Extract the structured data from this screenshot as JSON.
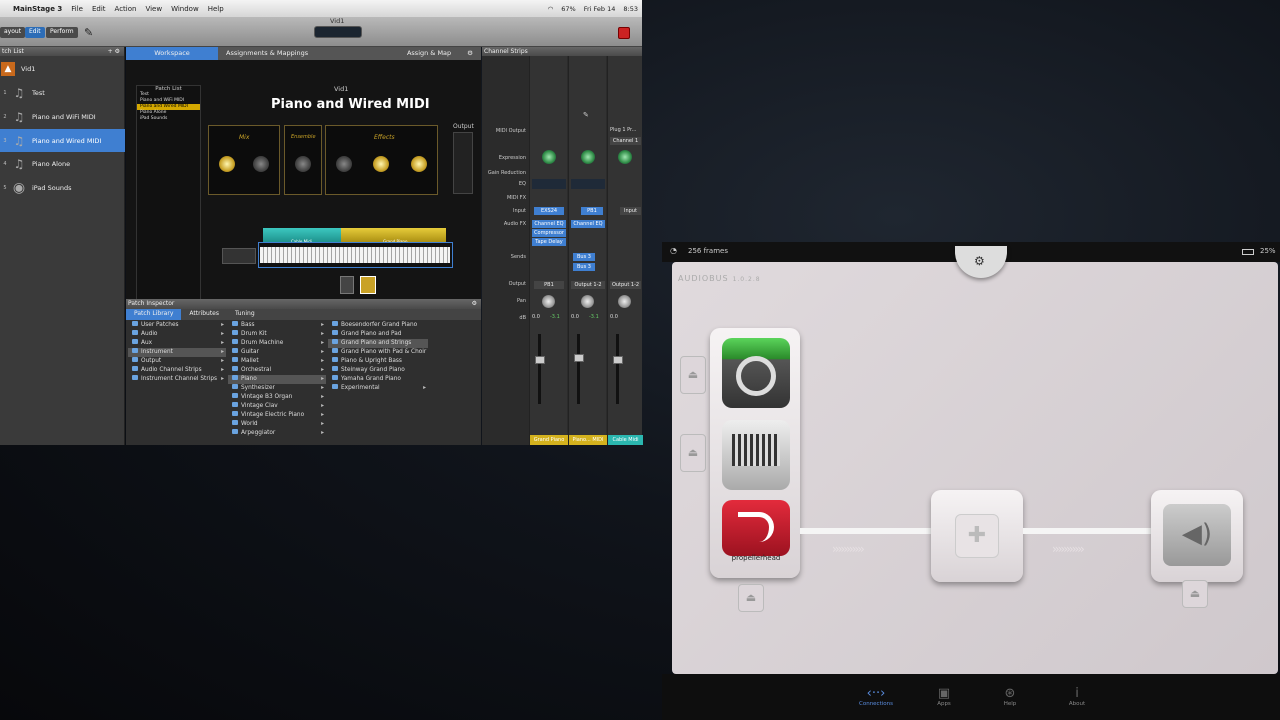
{
  "menubar": {
    "app": "MainStage 3",
    "menus": [
      "File",
      "Edit",
      "Action",
      "View",
      "Window",
      "Help"
    ],
    "status_right": [
      "67%",
      "Fri Feb 14",
      "8:53"
    ]
  },
  "toolbar": {
    "layout": "ayout",
    "edit": "Edit",
    "perform": "Perform",
    "doc_title": "Vid1"
  },
  "patch_list": {
    "header": "tch List",
    "concert": "Vid1",
    "items": [
      {
        "num": "1",
        "label": "Test"
      },
      {
        "num": "2",
        "label": "Piano and WiFi MIDI"
      },
      {
        "num": "3",
        "label": "Piano and Wired MIDI"
      },
      {
        "num": "4",
        "label": "Piano Alone"
      },
      {
        "num": "5",
        "label": "iPad Sounds"
      }
    ]
  },
  "workspace": {
    "tabs": [
      "Workspace",
      "Assignments & Mappings",
      "Assign & Map"
    ],
    "mini_title": "Patch List",
    "mini_items": [
      "Test",
      "Piano and WiFi MIDI",
      "Piano and Wired MIDI",
      "Piano Alone",
      "iPad Sounds"
    ],
    "subtitle": "Vid1",
    "title": "Piano and Wired MIDI",
    "output": "Output",
    "k1": "Mix",
    "k2": "Ensemble",
    "k3": "Effects",
    "kbd_left": "Cable Midi",
    "kbd_right": "Grand Piano"
  },
  "inspector": {
    "header": "Patch Inspector",
    "tabs": [
      "Patch Library",
      "Attributes",
      "Tuning"
    ],
    "col1": [
      "User Patches",
      "Audio",
      "Aux",
      "Instrument",
      "Output",
      "Audio Channel Strips",
      "Instrument Channel Strips"
    ],
    "col2": [
      "Bass",
      "Drum Kit",
      "Drum Machine",
      "Guitar",
      "Mallet",
      "Orchestral",
      "Piano",
      "Synthesizer",
      "Vintage B3 Organ",
      "Vintage Clav",
      "Vintage Electric Piano",
      "World",
      "Arpeggiator"
    ],
    "col3": [
      "Boesendorfer Grand Piano",
      "Grand Piano and Pad",
      "Grand Piano and Strings",
      "Grand Piano with Pad & Choir",
      "Piano & Upright Bass",
      "Steinway Grand Piano",
      "Yamaha Grand Piano",
      "Experimental"
    ]
  },
  "strips": {
    "header": "Channel Strips",
    "labels": [
      "MIDI Output",
      "Expression",
      "Gain Reduction",
      "EQ",
      "MIDI FX",
      "Input",
      "Audio FX",
      "Sends",
      "Output",
      "Pan",
      "dB"
    ],
    "plug": "Plug 1 Pr...",
    "channel1": "Channel 1",
    "input": [
      "EXS24",
      "PB1",
      "Input"
    ],
    "fx": [
      "Channel EQ",
      "Compressor",
      "Tape Delay",
      "Channel EQ"
    ],
    "sends": [
      "Bus 3",
      "Bus 3"
    ],
    "outputs": [
      "PB1",
      "Output 1-2",
      "Output 1-2"
    ],
    "db": [
      "0.0",
      "-3.1",
      "0.0",
      "-3.1",
      "0.0"
    ],
    "names": [
      "Grand Piano",
      "Piano... MIDI",
      "Cable Midi"
    ]
  },
  "ipad": {
    "frames": "256 frames",
    "battery": "25%",
    "app": "AUDIOBUS",
    "version": "1.0.2.8",
    "propellerhead": "propellerhead",
    "nav": [
      "Connections",
      "Apps",
      "Help",
      "About"
    ]
  }
}
